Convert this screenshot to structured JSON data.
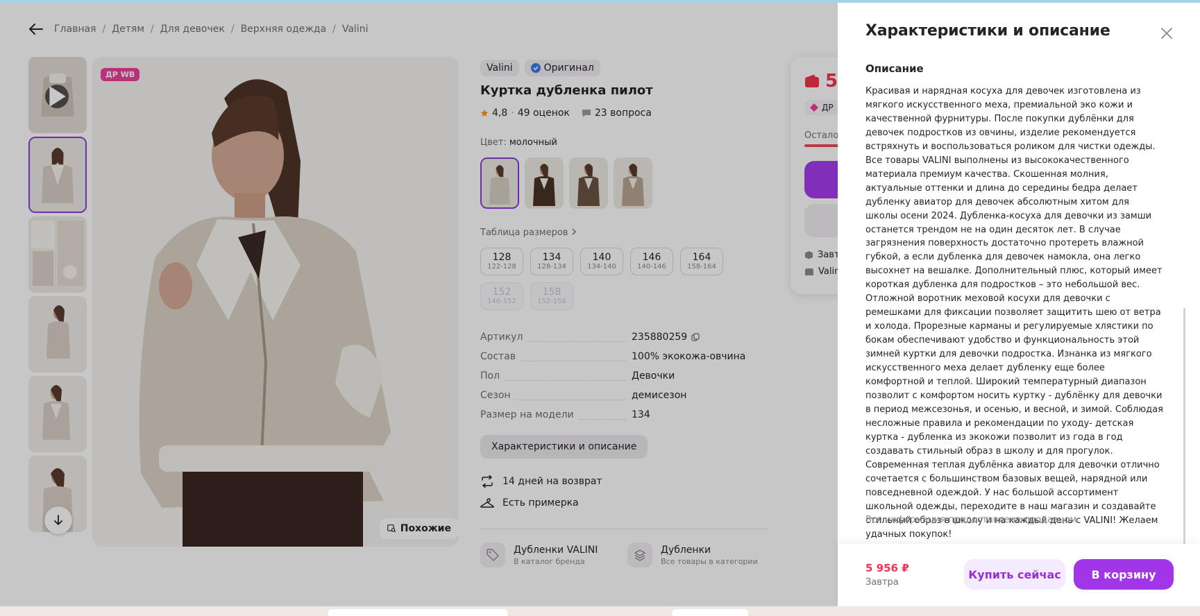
{
  "breadcrumbs": [
    "Главная",
    "Детям",
    "Для девочек",
    "Верхняя одежда",
    "Valini"
  ],
  "photo": {
    "badge": "ДР WB",
    "similar_label": "Похожие"
  },
  "product": {
    "brand": "Valini",
    "original_label": "Оригинал",
    "title": "Куртка дубленка пилот",
    "rating": "4,8",
    "dot": "·",
    "reviews": "49 оценок",
    "questions": "23 вопроса",
    "color_key": "Цвет:",
    "color_value": "молочный",
    "size_table_label": "Таблица размеров",
    "sizes": [
      {
        "n": "128",
        "r": "122-128",
        "available": true
      },
      {
        "n": "134",
        "r": "128-134",
        "available": true
      },
      {
        "n": "140",
        "r": "134-140",
        "available": true
      },
      {
        "n": "146",
        "r": "140-146",
        "available": true
      },
      {
        "n": "164",
        "r": "158-164",
        "available": true
      },
      {
        "n": "152",
        "r": "146-152",
        "available": false
      },
      {
        "n": "158",
        "r": "152-158",
        "available": false
      }
    ],
    "specs": [
      {
        "k": "Артикул",
        "v": "235880259"
      },
      {
        "k": "Состав",
        "v": "100% экокожа-овчина"
      },
      {
        "k": "Пол",
        "v": "Девочки"
      },
      {
        "k": "Сезон",
        "v": "демисезон"
      },
      {
        "k": "Размер на модели",
        "v": "134"
      }
    ],
    "specs_button": "Характеристики и описание",
    "features": [
      "14 дней на возврат",
      "Есть примерка"
    ],
    "brand_cards": [
      {
        "t": "Дубленки VALINI",
        "s": "В каталог бренда"
      },
      {
        "t": "Дубленки",
        "s": "Все товары в категории"
      }
    ]
  },
  "price_card": {
    "price_partial": "5",
    "dr_label": "ДР",
    "stock_partial": "Остало",
    "line1": "Завт",
    "line2": "Valin"
  },
  "panel": {
    "title": "Характеристики и описание",
    "section": "Описание",
    "description": "Красивая и нарядная косуха для девочек изготовлена из мягкого искусственного меха, премиальной эко кожи и качественной фурнитуры. После покупки дублёнки для девочек подростков из овчины, изделие рекомендуется встряхнуть и воспользоваться роликом для чистки одежды. Все товары VALINI выполнены из высококачественного материала премиум качества. Скошенная молния, актуальные оттенки и длина до середины бедра делает дубленку авиатор для девочек абсолютным хитом для школы осени 2024. Дубленка-косуха для девочки из замши останется трендом не на один десяток лет. В случае загрязнения поверхность достаточно протереть влажной губкой, а если дубленка для девочек намокла, она легко высохнет на вешалке. Дополнительный плюс, который имеет короткая дубленка для подростков – это небольшой вес. Отложной воротник меховой косухи для девочки с ремешками для фиксации позволяет защитить шею от ветра и холода. Прорезные карманы и регулируемые хлястики по бокам обеспечивают удобство и функциональность этой зимней куртки для девочки подростка. Изнанка из мягкого искусственного меха делает дубленку еще более комфортной и теплой. Широкий температурный диапазон позволит с комфортом носить куртку - дублёнку для девочки в период межсезонья, и осенью, и весной, и зимой. Соблюдая несложные правила и рекомендации по уходу- детская куртка - дубленка из экокожи позволит из года в год создавать стильный образ в школу и для прогулок. Современная теплая дублёнка авиатор для девочки отлично сочетается с большинством базовых вещей, нарядной или повседневной одеждой. У нас большой ассортимент школьной одежды, переходите в наш магазин и создавайте стильный образ в школу и на каждый день с VALINI! Желаем удачных покупок!",
    "note": "Вся информация предоставлена продавцом",
    "price": "5 956 ₽",
    "delivery": "Завтра",
    "buy_now": "Купить сейчас",
    "add_to_cart": "В корзину"
  },
  "colors": {
    "accent": "#a135e8",
    "price": "#f5324f",
    "badge": "#ee3f9e",
    "verified": "#3a7bea"
  }
}
